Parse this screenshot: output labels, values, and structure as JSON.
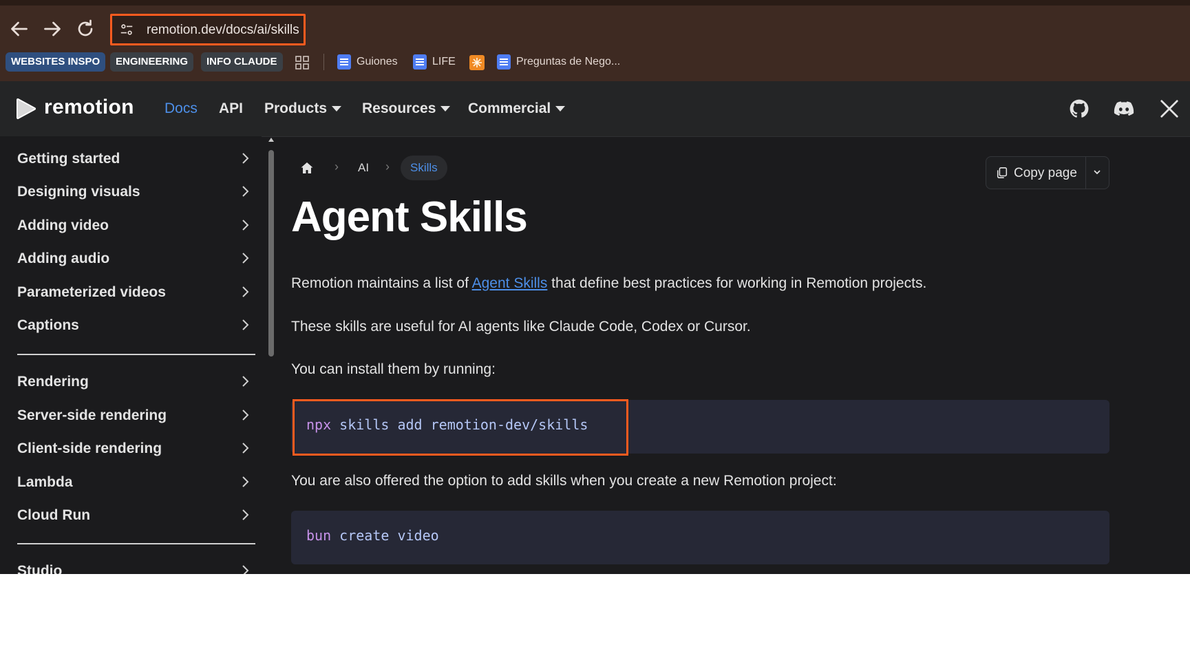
{
  "browser": {
    "url": "remotion.dev/docs/ai/skills",
    "bookmarks": [
      {
        "label": "WEBSITES INSPO",
        "color": "#2f4f7f"
      },
      {
        "label": "ENGINEERING",
        "color": "#3a3f45"
      },
      {
        "label": "INFO CLAUDE",
        "color": "#3a3f45"
      }
    ],
    "bookmark_links": [
      "Guiones",
      "LIFE",
      "Preguntas de Nego..."
    ],
    "icons": {
      "back": "back-arrow-icon",
      "forward": "forward-arrow-icon",
      "reload": "reload-icon",
      "site_settings": "tune-icon",
      "apps": "apps-grid-icon"
    }
  },
  "navbar": {
    "brand": "remotion",
    "links": [
      {
        "label": "Docs",
        "active": true
      },
      {
        "label": "API"
      },
      {
        "label": "Products",
        "dropdown": true
      },
      {
        "label": "Resources",
        "dropdown": true
      },
      {
        "label": "Commercial",
        "dropdown": true
      }
    ],
    "social_icons": [
      "github-icon",
      "discord-icon",
      "x-icon"
    ]
  },
  "sidebar": {
    "groups": [
      [
        "Getting started",
        "Designing visuals",
        "Adding video",
        "Adding audio",
        "Parameterized videos",
        "Captions"
      ],
      [
        "Rendering",
        "Server-side rendering",
        "Client-side rendering",
        "Lambda",
        "Cloud Run"
      ],
      [
        "Studio"
      ]
    ]
  },
  "breadcrumb": {
    "items": [
      "AI",
      "Skills"
    ]
  },
  "copy_page": {
    "label": "Copy page"
  },
  "article": {
    "title": "Agent Skills",
    "p1_before": "Remotion maintains a list of ",
    "p1_link": "Agent Skills",
    "p1_after": " that define best practices for working in Remotion projects.",
    "p2": "These skills are useful for AI agents like Claude Code, Codex or Cursor.",
    "p3": "You can install them by running:",
    "code1": {
      "cmd": "npx",
      "rest": " skills add remotion-dev/skills"
    },
    "p4": "You are also offered the option to add skills when you create a new Remotion project:",
    "code2": {
      "cmd": "bun",
      "rest": " create video"
    }
  },
  "colors": {
    "accent": "#4d8fe8",
    "highlight_border": "#ff5b1f",
    "background": "#1b1b1d"
  }
}
